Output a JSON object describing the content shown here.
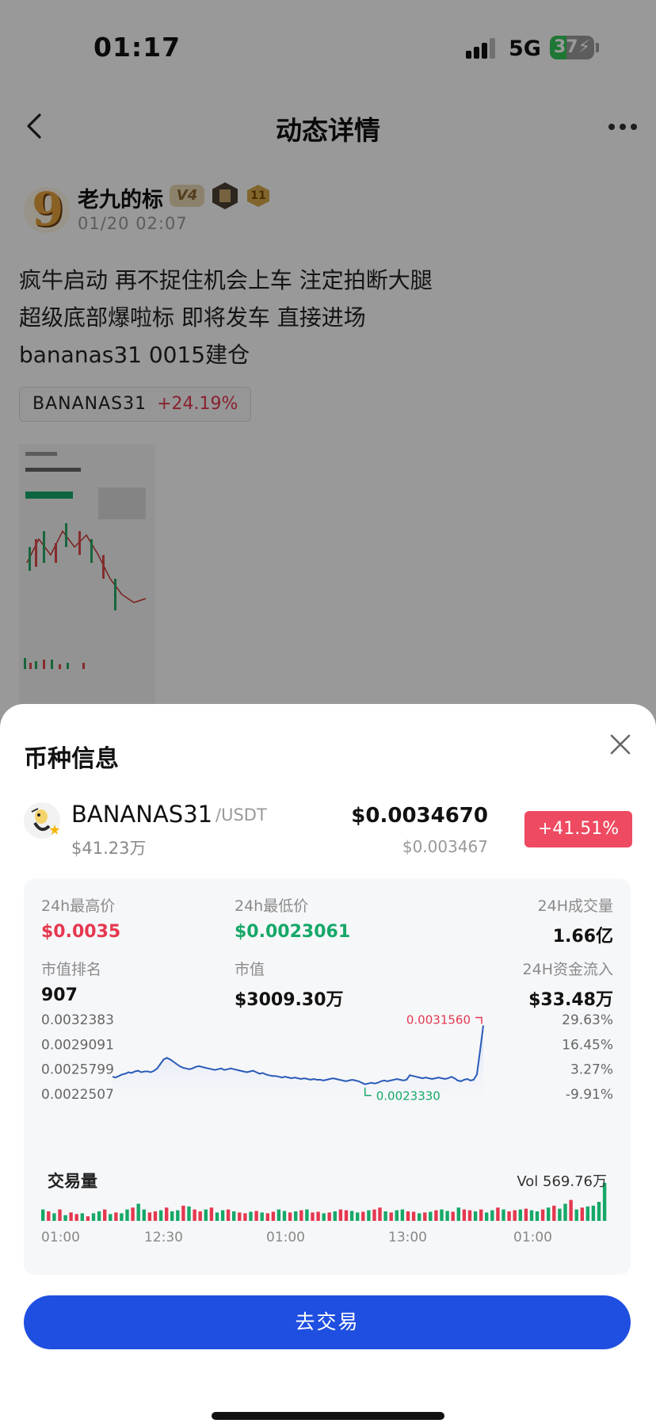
{
  "status_bar": {
    "time": "01:17",
    "network": "5G",
    "battery": "37",
    "battery_level": 0.37
  },
  "nav": {
    "title": "动态详情"
  },
  "post": {
    "author": {
      "name": "老九的标",
      "badge_level": "V4",
      "badge_rank": "11",
      "time": "01/20 02:07"
    },
    "lines": [
      "疯牛启动 再不捉住机会上车 注定拍断大腿",
      "超级底部爆啦标 即将发车 直接进场",
      "bananas31 0015建仓"
    ],
    "chip": {
      "symbol": "BANANAS31",
      "change": "+24.19%"
    }
  },
  "sheet": {
    "title": "币种信息",
    "coin": {
      "symbol": "BANANAS31",
      "quote": "/USDT",
      "market_cap": "$41.23万",
      "price": "$0.0034670",
      "price_sub": "$0.003467",
      "change": "+41.51%"
    },
    "stats": {
      "high_label": "24h最高价",
      "high_value": "$0.0035",
      "low_label": "24h最低价",
      "low_value": "$0.0023061",
      "volume_label": "24H成交量",
      "volume_value": "1.66亿",
      "rank_label": "市值排名",
      "rank_value": "907",
      "mcap_label": "市值",
      "mcap_value": "$3009.30万",
      "flow_label": "24H资金流入",
      "flow_value": "$33.48万"
    },
    "volume": {
      "title": "交易量",
      "value": "Vol 569.76万"
    },
    "trade_button": "去交易"
  },
  "colors": {
    "up": "#e5384f",
    "down": "#16a868",
    "line": "#2a5bb8",
    "accent": "#1f4fe0"
  },
  "chart_data": {
    "type": "line",
    "y_ticks": [
      "0.0032383",
      "0.0029091",
      "0.0025799",
      "0.0022507"
    ],
    "y_ticks_right": [
      "29.63%",
      "16.45%",
      "3.27%",
      "-9.91%"
    ],
    "ylim": [
      0.0022507,
      0.0032383
    ],
    "x_ticks": [
      "01:00",
      "12:30",
      "01:00",
      "13:00",
      "01:00"
    ],
    "max_label": "0.0031560",
    "min_label": "0.0023330",
    "price_series": [
      0.00248,
      0.00247,
      0.00249,
      0.00251,
      0.00252,
      0.00254,
      0.00253,
      0.00255,
      0.00256,
      0.00254,
      0.00255,
      0.00255,
      0.00254,
      0.00256,
      0.00259,
      0.00265,
      0.00271,
      0.00273,
      0.00271,
      0.00268,
      0.00265,
      0.00262,
      0.0026,
      0.00259,
      0.00258,
      0.00259,
      0.00261,
      0.00262,
      0.00261,
      0.0026,
      0.00259,
      0.00258,
      0.00257,
      0.00258,
      0.00259,
      0.00257,
      0.00258,
      0.00259,
      0.00258,
      0.00257,
      0.00256,
      0.00255,
      0.00254,
      0.00255,
      0.00256,
      0.00254,
      0.00252,
      0.00253,
      0.00251,
      0.0025,
      0.00249,
      0.00249,
      0.00248,
      0.00247,
      0.00248,
      0.00247,
      0.00246,
      0.00247,
      0.00246,
      0.00245,
      0.00246,
      0.00245,
      0.00244,
      0.00245,
      0.00244,
      0.00244,
      0.00243,
      0.00244,
      0.00245,
      0.00246,
      0.00245,
      0.00244,
      0.00243,
      0.00242,
      0.00243,
      0.00244,
      0.00243,
      0.00242,
      0.0024,
      0.00238,
      0.00239,
      0.0024,
      0.00239,
      0.0024,
      0.00242,
      0.00243,
      0.00242,
      0.00243,
      0.00244,
      0.00245,
      0.00244,
      0.00243,
      0.00244,
      0.0025,
      0.00249,
      0.00248,
      0.00247,
      0.00246,
      0.00247,
      0.00246,
      0.00245,
      0.00246,
      0.00247,
      0.00246,
      0.00245,
      0.00246,
      0.00248,
      0.00246,
      0.00243,
      0.00242,
      0.00244,
      0.00245,
      0.00243,
      0.00244,
      0.00251,
      0.00283,
      0.00316
    ],
    "volume_series": [
      0.3,
      0.25,
      0.2,
      0.3,
      0.15,
      0.22,
      0.18,
      0.2,
      0.12,
      0.2,
      0.25,
      0.3,
      0.18,
      0.22,
      0.2,
      0.3,
      0.35,
      0.45,
      0.3,
      0.22,
      0.25,
      0.28,
      0.35,
      0.25,
      0.28,
      0.4,
      0.38,
      0.3,
      0.25,
      0.3,
      0.35,
      0.22,
      0.28,
      0.3,
      0.25,
      0.22,
      0.2,
      0.24,
      0.26,
      0.22,
      0.2,
      0.24,
      0.3,
      0.26,
      0.22,
      0.25,
      0.28,
      0.3,
      0.22,
      0.24,
      0.2,
      0.22,
      0.25,
      0.3,
      0.28,
      0.26,
      0.22,
      0.24,
      0.28,
      0.3,
      0.35,
      0.25,
      0.22,
      0.28,
      0.3,
      0.25,
      0.24,
      0.2,
      0.22,
      0.24,
      0.28,
      0.3,
      0.26,
      0.24,
      0.35,
      0.3,
      0.28,
      0.25,
      0.3,
      0.22,
      0.28,
      0.35,
      0.3,
      0.25,
      0.28,
      0.3,
      0.32,
      0.28,
      0.25,
      0.3,
      0.35,
      0.4,
      0.32,
      0.45,
      0.55,
      0.3,
      0.35,
      0.38,
      0.4,
      0.5,
      1.0
    ],
    "volume_up": [
      1,
      0,
      1,
      0,
      1,
      0,
      0,
      1,
      0,
      1,
      1,
      0,
      1,
      0,
      1,
      1,
      0,
      1,
      1,
      0,
      0,
      1,
      0,
      1,
      1,
      0,
      1,
      0,
      0,
      1,
      0,
      1,
      1,
      0,
      1,
      0,
      0,
      1,
      0,
      1,
      0,
      0,
      1,
      1,
      0,
      1,
      0,
      1,
      0,
      0,
      1,
      0,
      1,
      0,
      0,
      1,
      1,
      0,
      1,
      0,
      0,
      1,
      0,
      1,
      1,
      0,
      0,
      1,
      0,
      1,
      0,
      1,
      1,
      0,
      1,
      0,
      0,
      1,
      0,
      1,
      1,
      0,
      1,
      0,
      0,
      1,
      0,
      1,
      1,
      0,
      1,
      0,
      1,
      1,
      0,
      1,
      0,
      1,
      1,
      1,
      1
    ]
  }
}
